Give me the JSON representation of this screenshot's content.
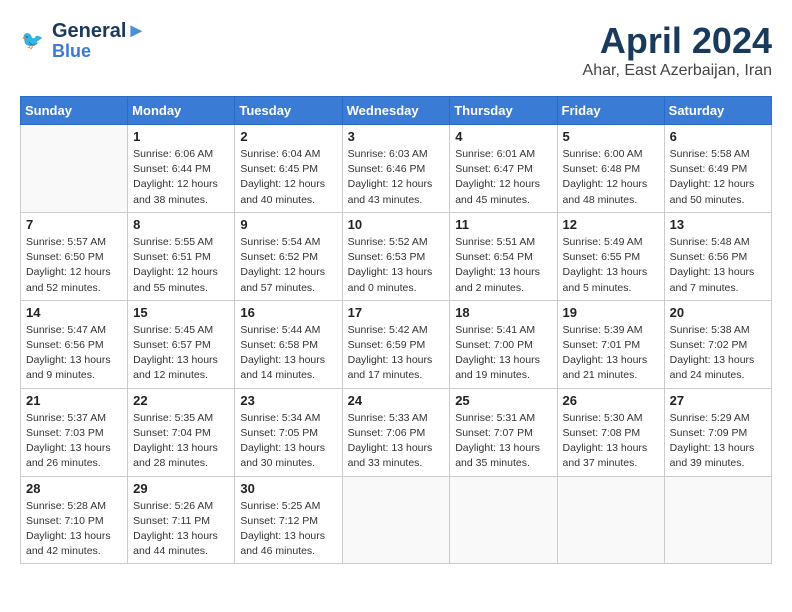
{
  "header": {
    "logo_line1": "General",
    "logo_line2": "Blue",
    "month": "April 2024",
    "location": "Ahar, East Azerbaijan, Iran"
  },
  "weekdays": [
    "Sunday",
    "Monday",
    "Tuesday",
    "Wednesday",
    "Thursday",
    "Friday",
    "Saturday"
  ],
  "weeks": [
    [
      {
        "day": "",
        "info": ""
      },
      {
        "day": "1",
        "info": "Sunrise: 6:06 AM\nSunset: 6:44 PM\nDaylight: 12 hours\nand 38 minutes."
      },
      {
        "day": "2",
        "info": "Sunrise: 6:04 AM\nSunset: 6:45 PM\nDaylight: 12 hours\nand 40 minutes."
      },
      {
        "day": "3",
        "info": "Sunrise: 6:03 AM\nSunset: 6:46 PM\nDaylight: 12 hours\nand 43 minutes."
      },
      {
        "day": "4",
        "info": "Sunrise: 6:01 AM\nSunset: 6:47 PM\nDaylight: 12 hours\nand 45 minutes."
      },
      {
        "day": "5",
        "info": "Sunrise: 6:00 AM\nSunset: 6:48 PM\nDaylight: 12 hours\nand 48 minutes."
      },
      {
        "day": "6",
        "info": "Sunrise: 5:58 AM\nSunset: 6:49 PM\nDaylight: 12 hours\nand 50 minutes."
      }
    ],
    [
      {
        "day": "7",
        "info": "Sunrise: 5:57 AM\nSunset: 6:50 PM\nDaylight: 12 hours\nand 52 minutes."
      },
      {
        "day": "8",
        "info": "Sunrise: 5:55 AM\nSunset: 6:51 PM\nDaylight: 12 hours\nand 55 minutes."
      },
      {
        "day": "9",
        "info": "Sunrise: 5:54 AM\nSunset: 6:52 PM\nDaylight: 12 hours\nand 57 minutes."
      },
      {
        "day": "10",
        "info": "Sunrise: 5:52 AM\nSunset: 6:53 PM\nDaylight: 13 hours\nand 0 minutes."
      },
      {
        "day": "11",
        "info": "Sunrise: 5:51 AM\nSunset: 6:54 PM\nDaylight: 13 hours\nand 2 minutes."
      },
      {
        "day": "12",
        "info": "Sunrise: 5:49 AM\nSunset: 6:55 PM\nDaylight: 13 hours\nand 5 minutes."
      },
      {
        "day": "13",
        "info": "Sunrise: 5:48 AM\nSunset: 6:56 PM\nDaylight: 13 hours\nand 7 minutes."
      }
    ],
    [
      {
        "day": "14",
        "info": "Sunrise: 5:47 AM\nSunset: 6:56 PM\nDaylight: 13 hours\nand 9 minutes."
      },
      {
        "day": "15",
        "info": "Sunrise: 5:45 AM\nSunset: 6:57 PM\nDaylight: 13 hours\nand 12 minutes."
      },
      {
        "day": "16",
        "info": "Sunrise: 5:44 AM\nSunset: 6:58 PM\nDaylight: 13 hours\nand 14 minutes."
      },
      {
        "day": "17",
        "info": "Sunrise: 5:42 AM\nSunset: 6:59 PM\nDaylight: 13 hours\nand 17 minutes."
      },
      {
        "day": "18",
        "info": "Sunrise: 5:41 AM\nSunset: 7:00 PM\nDaylight: 13 hours\nand 19 minutes."
      },
      {
        "day": "19",
        "info": "Sunrise: 5:39 AM\nSunset: 7:01 PM\nDaylight: 13 hours\nand 21 minutes."
      },
      {
        "day": "20",
        "info": "Sunrise: 5:38 AM\nSunset: 7:02 PM\nDaylight: 13 hours\nand 24 minutes."
      }
    ],
    [
      {
        "day": "21",
        "info": "Sunrise: 5:37 AM\nSunset: 7:03 PM\nDaylight: 13 hours\nand 26 minutes."
      },
      {
        "day": "22",
        "info": "Sunrise: 5:35 AM\nSunset: 7:04 PM\nDaylight: 13 hours\nand 28 minutes."
      },
      {
        "day": "23",
        "info": "Sunrise: 5:34 AM\nSunset: 7:05 PM\nDaylight: 13 hours\nand 30 minutes."
      },
      {
        "day": "24",
        "info": "Sunrise: 5:33 AM\nSunset: 7:06 PM\nDaylight: 13 hours\nand 33 minutes."
      },
      {
        "day": "25",
        "info": "Sunrise: 5:31 AM\nSunset: 7:07 PM\nDaylight: 13 hours\nand 35 minutes."
      },
      {
        "day": "26",
        "info": "Sunrise: 5:30 AM\nSunset: 7:08 PM\nDaylight: 13 hours\nand 37 minutes."
      },
      {
        "day": "27",
        "info": "Sunrise: 5:29 AM\nSunset: 7:09 PM\nDaylight: 13 hours\nand 39 minutes."
      }
    ],
    [
      {
        "day": "28",
        "info": "Sunrise: 5:28 AM\nSunset: 7:10 PM\nDaylight: 13 hours\nand 42 minutes."
      },
      {
        "day": "29",
        "info": "Sunrise: 5:26 AM\nSunset: 7:11 PM\nDaylight: 13 hours\nand 44 minutes."
      },
      {
        "day": "30",
        "info": "Sunrise: 5:25 AM\nSunset: 7:12 PM\nDaylight: 13 hours\nand 46 minutes."
      },
      {
        "day": "",
        "info": ""
      },
      {
        "day": "",
        "info": ""
      },
      {
        "day": "",
        "info": ""
      },
      {
        "day": "",
        "info": ""
      }
    ]
  ]
}
